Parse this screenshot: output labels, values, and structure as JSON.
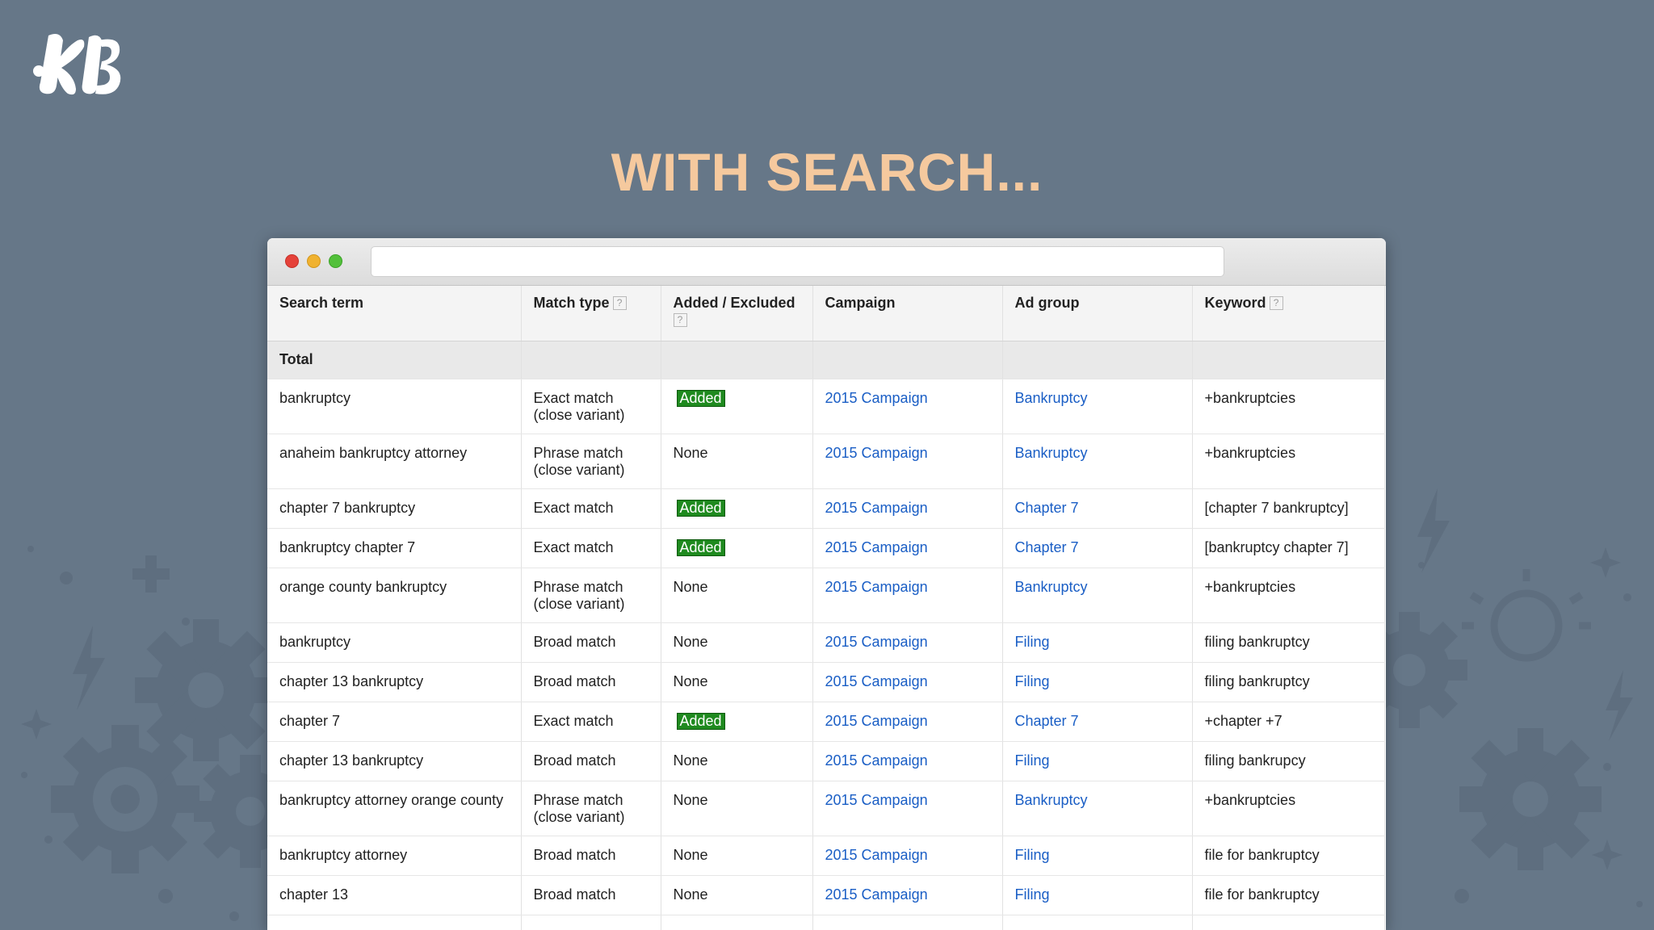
{
  "slide": {
    "title": "WITH SEARCH..."
  },
  "table": {
    "headers": {
      "search_term": "Search term",
      "match_type": "Match type",
      "added_excluded": "Added / Excluded",
      "campaign": "Campaign",
      "ad_group": "Ad group",
      "keyword": "Keyword",
      "help_glyph": "?"
    },
    "total_label": "Total",
    "rows": [
      {
        "search_term": "bankruptcy",
        "match_type": "Exact match (close variant)",
        "added": "Added",
        "campaign": "2015 Campaign",
        "ad_group": "Bankruptcy",
        "keyword": "+bankruptcies"
      },
      {
        "search_term": "anaheim bankruptcy attorney",
        "match_type": "Phrase match (close variant)",
        "added": "None",
        "campaign": "2015 Campaign",
        "ad_group": "Bankruptcy",
        "keyword": "+bankruptcies"
      },
      {
        "search_term": "chapter 7 bankruptcy",
        "match_type": "Exact match",
        "added": "Added",
        "campaign": "2015 Campaign",
        "ad_group": "Chapter 7",
        "keyword": "[chapter 7 bankruptcy]"
      },
      {
        "search_term": "bankruptcy chapter 7",
        "match_type": "Exact match",
        "added": "Added",
        "campaign": "2015 Campaign",
        "ad_group": "Chapter 7",
        "keyword": "[bankruptcy chapter 7]"
      },
      {
        "search_term": "orange county bankruptcy",
        "match_type": "Phrase match (close variant)",
        "added": "None",
        "campaign": "2015 Campaign",
        "ad_group": "Bankruptcy",
        "keyword": "+bankruptcies"
      },
      {
        "search_term": "bankruptcy",
        "match_type": "Broad match",
        "added": "None",
        "campaign": "2015 Campaign",
        "ad_group": "Filing",
        "keyword": "filing bankruptcy"
      },
      {
        "search_term": "chapter 13 bankruptcy",
        "match_type": "Broad match",
        "added": "None",
        "campaign": "2015 Campaign",
        "ad_group": "Filing",
        "keyword": "filing bankruptcy"
      },
      {
        "search_term": "chapter 7",
        "match_type": "Exact match",
        "added": "Added",
        "campaign": "2015 Campaign",
        "ad_group": "Chapter 7",
        "keyword": "+chapter +7"
      },
      {
        "search_term": "chapter 13 bankruptcy",
        "match_type": "Broad match",
        "added": "None",
        "campaign": "2015 Campaign",
        "ad_group": "Filing",
        "keyword": "filing bankrupcy"
      },
      {
        "search_term": "bankruptcy attorney orange county",
        "match_type": "Phrase match (close variant)",
        "added": "None",
        "campaign": "2015 Campaign",
        "ad_group": "Bankruptcy",
        "keyword": "+bankruptcies"
      },
      {
        "search_term": "bankruptcy attorney",
        "match_type": "Broad match",
        "added": "None",
        "campaign": "2015 Campaign",
        "ad_group": "Filing",
        "keyword": "file for bankruptcy"
      },
      {
        "search_term": "chapter 13",
        "match_type": "Broad match",
        "added": "None",
        "campaign": "2015 Campaign",
        "ad_group": "Filing",
        "keyword": "file for bankruptcy"
      },
      {
        "search_term": "",
        "match_type": "",
        "added": "",
        "campaign": "",
        "ad_group": "",
        "keyword": ""
      }
    ]
  },
  "colors": {
    "background": "#667788",
    "title": "#f5c99e",
    "link": "#1a5ec5",
    "added_badge": "#1f8a1f"
  },
  "icons": [
    "kb-logo",
    "gear-icon",
    "lightning-icon",
    "sparkle-icon",
    "lightbulb-icon",
    "plus-icon",
    "help-icon"
  ]
}
